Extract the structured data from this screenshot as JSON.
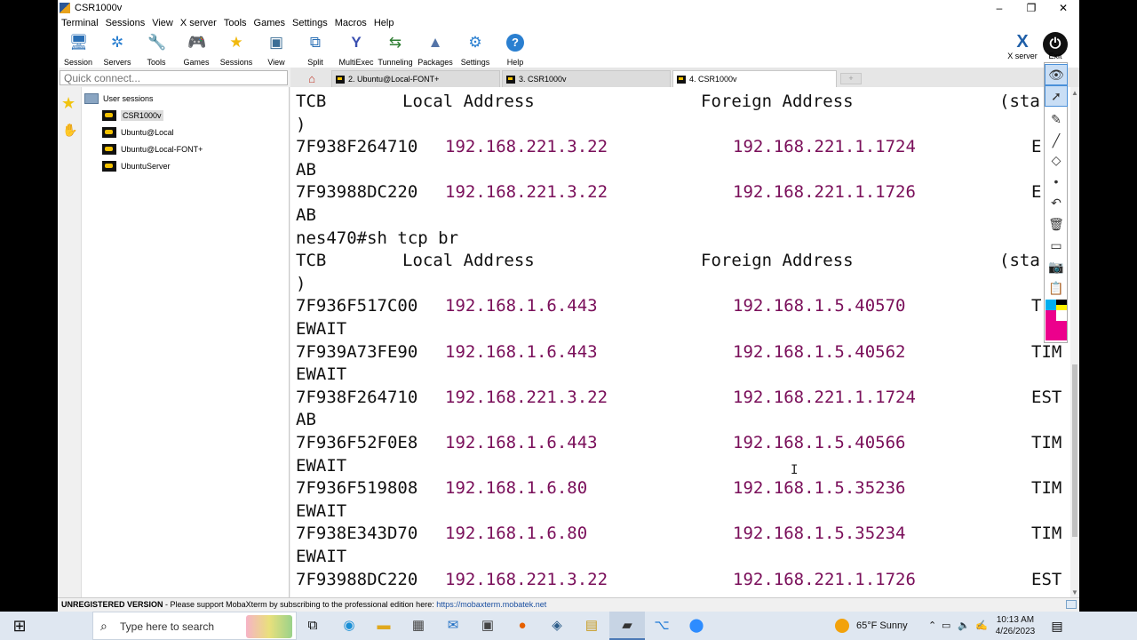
{
  "window": {
    "title": "CSR1000v"
  },
  "menu": [
    "Terminal",
    "Sessions",
    "View",
    "X server",
    "Tools",
    "Games",
    "Settings",
    "Macros",
    "Help"
  ],
  "toolbar": [
    {
      "label": "Session",
      "icon": "session-icon",
      "glyph": "🖥"
    },
    {
      "label": "Servers",
      "icon": "servers-icon",
      "glyph": "✲"
    },
    {
      "label": "Tools",
      "icon": "tools-icon",
      "glyph": "🔧"
    },
    {
      "label": "Games",
      "icon": "games-icon",
      "glyph": "🎮"
    },
    {
      "label": "Sessions",
      "icon": "star-icon",
      "glyph": "★"
    },
    {
      "label": "View",
      "icon": "view-icon",
      "glyph": "▣"
    },
    {
      "label": "Split",
      "icon": "split-icon",
      "glyph": "⧉"
    },
    {
      "label": "MultiExec",
      "icon": "multiexec-icon",
      "glyph": "Y"
    },
    {
      "label": "Tunneling",
      "icon": "tunneling-icon",
      "glyph": "⇆"
    },
    {
      "label": "Packages",
      "icon": "packages-icon",
      "glyph": "▲"
    },
    {
      "label": "Settings",
      "icon": "gear-icon",
      "glyph": "⚙"
    },
    {
      "label": "Help",
      "icon": "help-icon",
      "glyph": "?"
    }
  ],
  "xserver": {
    "label": "X server",
    "glyph": "X"
  },
  "exit": {
    "label": "Exit",
    "glyph": "⏻"
  },
  "quick_connect": {
    "placeholder": "Quick connect..."
  },
  "tabs": [
    {
      "label": "2. Ubuntu@Local-FONT+",
      "active": false
    },
    {
      "label": "3. CSR1000v",
      "active": false
    },
    {
      "label": "4. CSR1000v",
      "active": true
    }
  ],
  "sidebar": {
    "root": "User sessions",
    "sessions": [
      "CSR1000v",
      "Ubuntu@Local",
      "Ubuntu@Local-FONT+",
      "UbuntuServer"
    ]
  },
  "terminal_lines": [
    {
      "type": "header",
      "c1": "TCB",
      "c2": "Local Address",
      "c3": "Foreign Address",
      "c4": "(sta"
    },
    {
      "type": "text",
      "text": ")"
    },
    {
      "type": "row",
      "tcb": "7F938F264710",
      "local": "192.168.221.3.22",
      "foreign": "192.168.221.1.1724",
      "state": "E"
    },
    {
      "type": "text",
      "text": "AB"
    },
    {
      "type": "row",
      "tcb": "7F93988DC220",
      "local": "192.168.221.3.22",
      "foreign": "192.168.221.1.1726",
      "state": "E"
    },
    {
      "type": "text",
      "text": "AB"
    },
    {
      "type": "text",
      "text": "nes470#sh tcp br"
    },
    {
      "type": "header",
      "c1": "TCB",
      "c2": "Local Address",
      "c3": "Foreign Address",
      "c4": "(sta"
    },
    {
      "type": "text",
      "text": ")"
    },
    {
      "type": "row",
      "tcb": "7F936F517C00",
      "local": "192.168.1.6.443",
      "foreign": "192.168.1.5.40570",
      "state": "T"
    },
    {
      "type": "text",
      "text": "EWAIT"
    },
    {
      "type": "row",
      "tcb": "7F939A73FE90",
      "local": "192.168.1.6.443",
      "foreign": "192.168.1.5.40562",
      "state": "TIM"
    },
    {
      "type": "text",
      "text": "EWAIT"
    },
    {
      "type": "row",
      "tcb": "7F938F264710",
      "local": "192.168.221.3.22",
      "foreign": "192.168.221.1.1724",
      "state": "EST"
    },
    {
      "type": "text",
      "text": "AB"
    },
    {
      "type": "row",
      "tcb": "7F936F52F0E8",
      "local": "192.168.1.6.443",
      "foreign": "192.168.1.5.40566",
      "state": "TIM"
    },
    {
      "type": "text",
      "text": "EWAIT"
    },
    {
      "type": "row",
      "tcb": "7F936F519808",
      "local": "192.168.1.6.80",
      "foreign": "192.168.1.5.35236",
      "state": "TIM"
    },
    {
      "type": "text",
      "text": "EWAIT"
    },
    {
      "type": "row",
      "tcb": "7F938E343D70",
      "local": "192.168.1.6.80",
      "foreign": "192.168.1.5.35234",
      "state": "TIM"
    },
    {
      "type": "text",
      "text": "EWAIT"
    },
    {
      "type": "row",
      "tcb": "7F93988DC220",
      "local": "192.168.221.3.22",
      "foreign": "192.168.221.1.1726",
      "state": "EST"
    }
  ],
  "status": {
    "bold": "UNREGISTERED VERSION",
    "message": " -  Please support MobaXterm by subscribing to the professional edition here: ",
    "link": "https://mobaxterm.mobatek.net"
  },
  "taskbar": {
    "search_placeholder": "Type here to search",
    "weather": "65°F  Sunny",
    "time": "10:13 AM",
    "date": "4/26/2023"
  },
  "colors": {
    "ip": "#7a0f5a",
    "accent": "#4a90d9"
  }
}
